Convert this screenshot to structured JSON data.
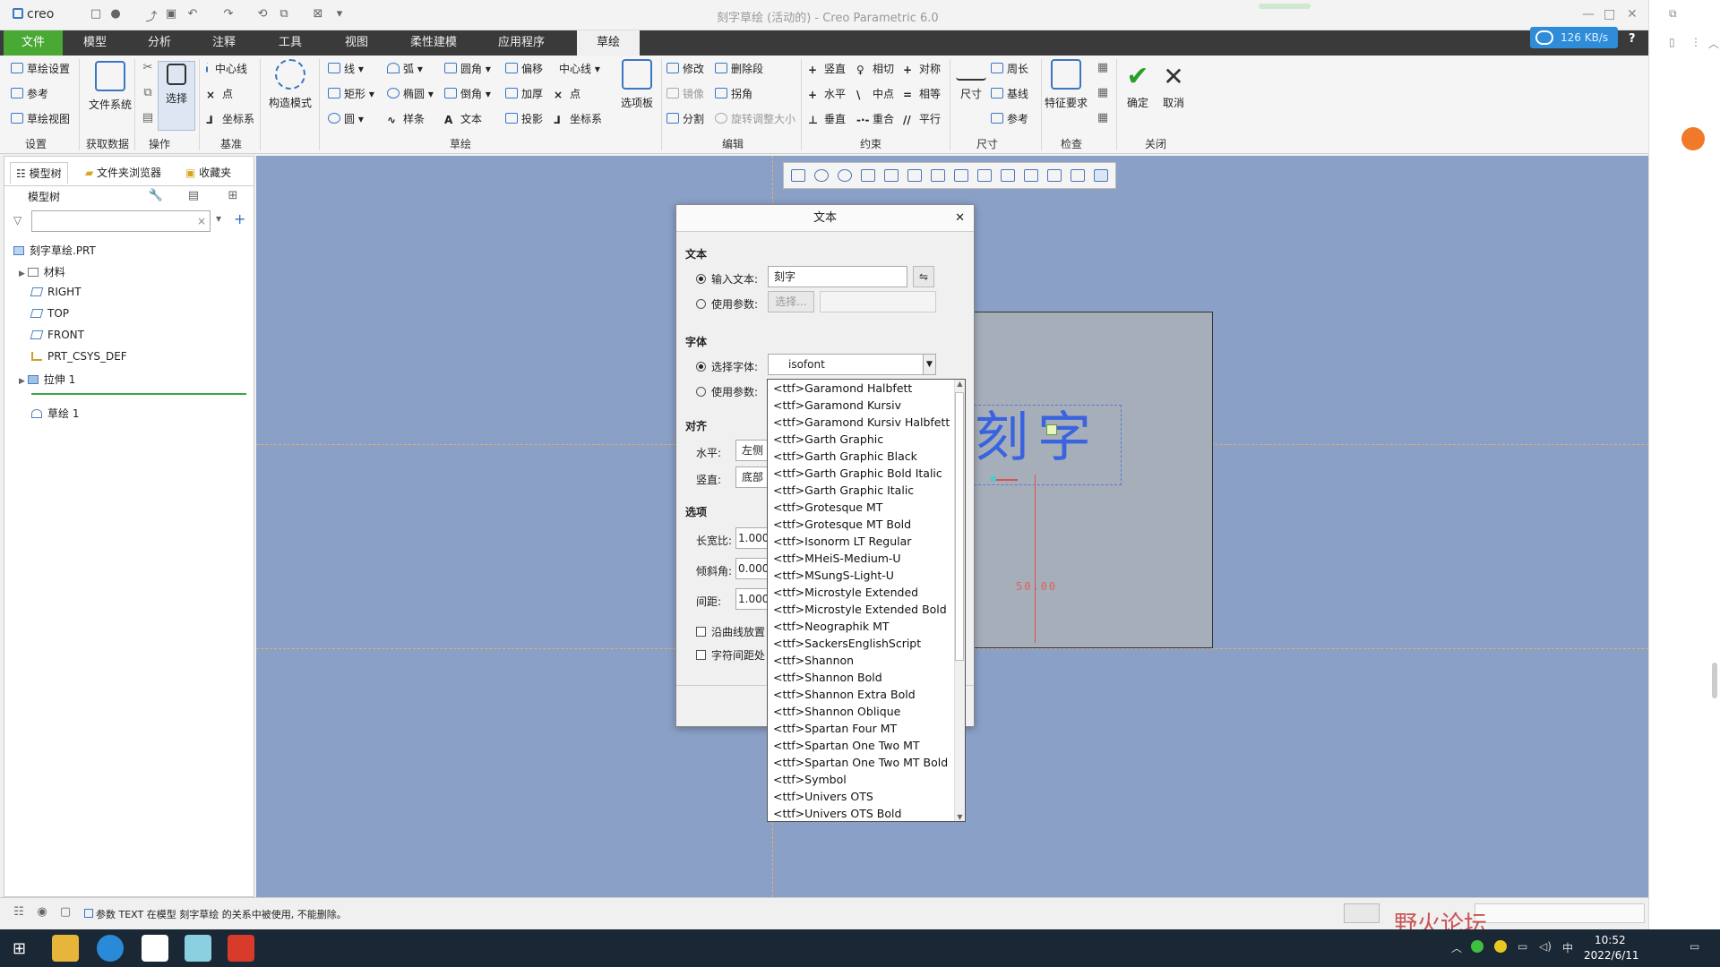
{
  "window": {
    "title": "刻字草绘 (活动的) - Creo Parametric 6.0",
    "app_name": "creo"
  },
  "menu_tabs": [
    "文件",
    "模型",
    "分析",
    "注释",
    "工具",
    "视图",
    "柔性建模",
    "应用程序",
    "草绘"
  ],
  "net_speed": "126 KB/s",
  "ribbon": {
    "setup": {
      "items": [
        "草绘设置",
        "参考",
        "草绘视图"
      ],
      "group": "设置"
    },
    "getdata": {
      "label": "文件系统",
      "group": "获取数据"
    },
    "ops": {
      "label": "选择",
      "group": "操作"
    },
    "datum": {
      "items": [
        "中心线",
        "点",
        "坐标系"
      ],
      "group": "基准"
    },
    "construct": {
      "label": "构造模式"
    },
    "sketch": {
      "items": [
        "线",
        "弧",
        "圆角",
        "偏移",
        "中心线",
        "矩形",
        "椭圆",
        "倒角",
        "加厚",
        "点",
        "圆",
        "样条",
        "文本",
        "投影",
        "坐标系"
      ],
      "group": "草绘"
    },
    "palette": {
      "label": "选项板"
    },
    "edit": {
      "items": [
        "修改",
        "删除段",
        "镜像",
        "拐角",
        "分割",
        "旋转调整大小"
      ],
      "group": "编辑"
    },
    "constrain": {
      "items": [
        "竖直",
        "相切",
        "对称",
        "水平",
        "中点",
        "相等",
        "垂直",
        "重合",
        "平行"
      ],
      "group": "约束"
    },
    "dimension": {
      "label": "尺寸",
      "items": [
        "周长",
        "基线",
        "参考"
      ],
      "group": "尺寸"
    },
    "inspect": {
      "label": "特征要求",
      "group": "检查"
    },
    "close": {
      "ok": "确定",
      "cancel": "取消",
      "group": "关闭"
    }
  },
  "left_panel": {
    "tabs": [
      "模型树",
      "文件夹浏览器",
      "收藏夹"
    ],
    "tree_header": "模型树",
    "tree": [
      "刻字草绘.PRT",
      "材料",
      "RIGHT",
      "TOP",
      "FRONT",
      "PRT_CSYS_DEF",
      "拉伸 1",
      "草绘 1"
    ]
  },
  "canvas": {
    "sketch_text": "刻字",
    "dimension": "50.00"
  },
  "dialog": {
    "title": "文本",
    "section_text": "文本",
    "input_text_label": "输入文本:",
    "input_text_value": "刻字",
    "use_param_label": "使用参数:",
    "select_button": "选择...",
    "section_font": "字体",
    "select_font_label": "选择字体:",
    "font_value": "isofont",
    "use_param_label2": "使用参数:",
    "section_align": "对齐",
    "horizontal_label": "水平:",
    "horizontal_value": "左侧",
    "vertical_label": "竖直:",
    "vertical_value": "底部",
    "section_options": "选项",
    "aspect_label": "长宽比:",
    "aspect_value": "1.000",
    "slant_label": "倾斜角:",
    "slant_value": "0.000",
    "spacing_label": "间距:",
    "spacing_value": "1.000",
    "along_curve": "沿曲线放置",
    "char_spacing": "字符间距处"
  },
  "font_options": [
    "<ttf>Garamond Halbfett",
    "<ttf>Garamond Kursiv",
    "<ttf>Garamond Kursiv Halbfett",
    "<ttf>Garth Graphic",
    "<ttf>Garth Graphic Black",
    "<ttf>Garth Graphic Bold Italic",
    "<ttf>Garth Graphic Italic",
    "<ttf>Grotesque MT",
    "<ttf>Grotesque MT Bold",
    "<ttf>Isonorm LT Regular",
    "<ttf>MHeiS-Medium-U",
    "<ttf>MSungS-Light-U",
    "<ttf>Microstyle Extended",
    "<ttf>Microstyle Extended Bold",
    "<ttf>Neographik MT",
    "<ttf>SackersEnglishScript",
    "<ttf>Shannon",
    "<ttf>Shannon Bold",
    "<ttf>Shannon Extra Bold",
    "<ttf>Shannon Oblique",
    "<ttf>Spartan Four MT",
    "<ttf>Spartan One Two MT",
    "<ttf>Spartan One Two MT Bold",
    "<ttf>Symbol",
    "<ttf>Univers OTS",
    "<ttf>Univers OTS Bold"
  ],
  "status": {
    "message": "参数 TEXT 在模型 刻字草绘 的关系中被使用, 不能删除。"
  },
  "taskbar": {
    "time": "10:52",
    "date": "2022/6/11"
  },
  "watermark": "野火论坛"
}
